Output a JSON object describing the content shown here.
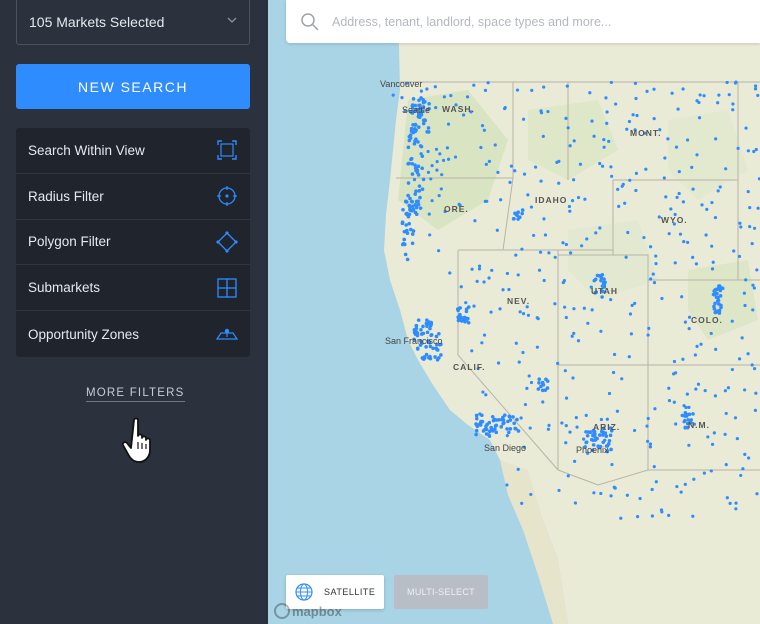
{
  "sidebar": {
    "market_select": "105 Markets Selected",
    "new_search": "NEW SEARCH",
    "filters": [
      {
        "label": "Search Within View",
        "icon": "expand-view-icon"
      },
      {
        "label": "Radius Filter",
        "icon": "radius-target-icon"
      },
      {
        "label": "Polygon Filter",
        "icon": "polygon-icon"
      },
      {
        "label": "Submarkets",
        "icon": "grid-icon"
      },
      {
        "label": "Opportunity Zones",
        "icon": "zone-icon"
      }
    ],
    "more_filters": "MORE FILTERS"
  },
  "search": {
    "placeholder": "Address, tenant, landlord, space types and more..."
  },
  "map": {
    "state_labels": [
      "WASH.",
      "MONT.",
      "ORE.",
      "IDAHO",
      "WYO.",
      "NEV.",
      "UTAH",
      "COLO.",
      "CALIF.",
      "ARIZ.",
      "N.M."
    ],
    "city_labels": [
      "Vancouver",
      "Seattle",
      "San Francisco",
      "San Diego",
      "Phoenix"
    ],
    "satellite_label": "SATELLITE",
    "multiselect_label": "MULTI-SELECT",
    "attribution": "mapbox",
    "marker_color": "#2f8cff"
  }
}
